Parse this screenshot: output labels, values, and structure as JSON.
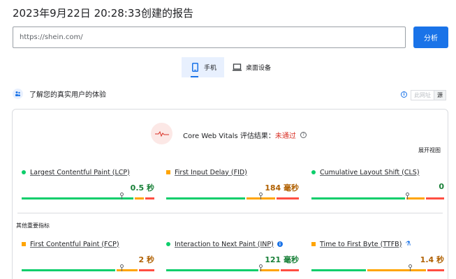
{
  "report": {
    "title": "2023年9月22日 20:28:33创建的报告"
  },
  "search": {
    "value": "https://shein.com/",
    "button_label": "分析"
  },
  "device_tabs": [
    {
      "label": "手机",
      "icon": "smartphone-icon",
      "selected": true
    },
    {
      "label": "桌面设备",
      "icon": "laptop-icon",
      "selected": false
    }
  ],
  "field_data": {
    "section_title": "了解您的真实用户的体验",
    "scope_toggle": {
      "url_label": "此网址",
      "origin_label": "源"
    },
    "assessment_label": "Core Web Vitals 评估结果：",
    "assessment_status": "未通过",
    "expand_label": "展开视图",
    "other_metrics_label": "其他重要指标"
  },
  "metrics": [
    {
      "name": "Largest Contentful Paint (LCP)",
      "value": "0.5 秒",
      "rating": "good",
      "indicator": "dot",
      "distribution": [
        0.86,
        0.07,
        0.07
      ],
      "p75": 0.75
    },
    {
      "name": "First Input Delay (FID)",
      "value": "184 毫秒",
      "rating": "average",
      "indicator": "square",
      "distribution": [
        0.61,
        0.22,
        0.17
      ],
      "p75": 0.71
    },
    {
      "name": "Cumulative Layout Shift (CLS)",
      "value": "0",
      "rating": "good",
      "indicator": "dot",
      "distribution": [
        0.72,
        0.14,
        0.14
      ],
      "p75": 0.72
    },
    {
      "name": "First Contentful Paint (FCP)",
      "value": "2 秒",
      "rating": "average",
      "indicator": "square",
      "distribution": [
        0.72,
        0.16,
        0.12
      ],
      "p75": 0.75
    },
    {
      "name": "Interaction to Next Paint (INP)",
      "value": "121 毫秒",
      "rating": "good",
      "indicator": "dot",
      "info": true,
      "distribution": [
        0.71,
        0.15,
        0.14
      ],
      "p75": 0.71
    },
    {
      "name": "Time to First Byte (TTFB)",
      "value": "1.4 秒",
      "rating": "average",
      "indicator": "square",
      "experimental": true,
      "distribution": [
        0.42,
        0.45,
        0.13
      ],
      "p75": 0.74
    }
  ],
  "colors": {
    "good": "#0cce6b",
    "average": "#ffa400",
    "poor": "#ff4e42",
    "accent": "#1a73e8",
    "fail": "#d93025"
  }
}
